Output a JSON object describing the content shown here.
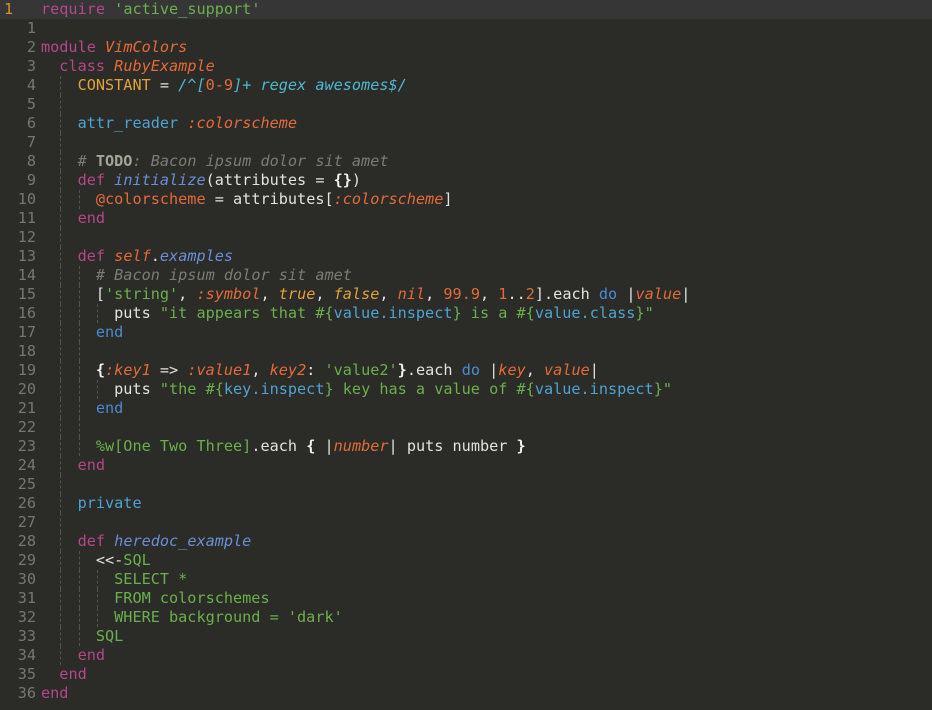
{
  "editor": {
    "language": "ruby",
    "cursor_line": 1,
    "colors": {
      "background": "#2b2b28",
      "current_line": "#363636",
      "line_number": "#777770",
      "line_number_current": "#d8922c",
      "keyword": "#b5478b",
      "method_name": "#6a8fd4",
      "class_name": "#e36b3a",
      "string": "#6ab04c",
      "comment": "#7c7c74",
      "constant": "#e0a23a"
    },
    "lines": [
      {
        "n": "1",
        "indent": [],
        "tokens": [
          [
            "t-kw",
            "require"
          ],
          [
            "t-plain",
            " "
          ],
          [
            "t-str",
            "'active_support'"
          ]
        ]
      },
      {
        "n": "1",
        "indent": [],
        "tokens": []
      },
      {
        "n": "2",
        "indent": [],
        "tokens": [
          [
            "t-kw",
            "module"
          ],
          [
            "t-plain",
            " "
          ],
          [
            "t-cls",
            "VimColors"
          ]
        ]
      },
      {
        "n": "3",
        "indent": [],
        "tokens": [
          [
            "t-plain",
            "  "
          ],
          [
            "t-kw",
            "class"
          ],
          [
            "t-plain",
            " "
          ],
          [
            "t-cls",
            "RubyExample"
          ]
        ]
      },
      {
        "n": "4",
        "indent": [
          1
        ],
        "tokens": [
          [
            "t-plain",
            "    "
          ],
          [
            "t-const",
            "CONSTANT"
          ],
          [
            "t-plain",
            " = "
          ],
          [
            "t-regex",
            "/^["
          ],
          [
            "t-num",
            "0-9"
          ],
          [
            "t-regex",
            "]+ regex awesomes$/"
          ]
        ]
      },
      {
        "n": "5",
        "indent": [
          1
        ],
        "tokens": []
      },
      {
        "n": "6",
        "indent": [
          1
        ],
        "tokens": [
          [
            "t-plain",
            "    "
          ],
          [
            "t-cyan",
            "attr_reader"
          ],
          [
            "t-plain",
            " "
          ],
          [
            "t-sym",
            ":colorscheme"
          ]
        ]
      },
      {
        "n": "7",
        "indent": [
          1
        ],
        "tokens": []
      },
      {
        "n": "8",
        "indent": [
          1
        ],
        "tokens": [
          [
            "t-plain",
            "    "
          ],
          [
            "t-cmt",
            "# "
          ],
          [
            "t-todo",
            "TODO"
          ],
          [
            "t-cmt",
            ": Bacon ipsum dolor sit amet"
          ]
        ]
      },
      {
        "n": "9",
        "indent": [
          1
        ],
        "tokens": [
          [
            "t-plain",
            "    "
          ],
          [
            "t-kw",
            "def"
          ],
          [
            "t-plain",
            " "
          ],
          [
            "t-def",
            "initialize"
          ],
          [
            "t-plain",
            "(attributes = "
          ],
          [
            "t-bold",
            "{}"
          ],
          [
            "t-plain",
            ")"
          ]
        ]
      },
      {
        "n": "10",
        "indent": [
          1,
          2
        ],
        "tokens": [
          [
            "t-plain",
            "      "
          ],
          [
            "t-ivar",
            "@colorscheme"
          ],
          [
            "t-plain",
            " = attributes["
          ],
          [
            "t-sym",
            ":colorscheme"
          ],
          [
            "t-plain",
            "]"
          ]
        ]
      },
      {
        "n": "11",
        "indent": [
          1
        ],
        "tokens": [
          [
            "t-plain",
            "    "
          ],
          [
            "t-kw",
            "end"
          ]
        ]
      },
      {
        "n": "12",
        "indent": [
          1
        ],
        "tokens": []
      },
      {
        "n": "13",
        "indent": [
          1
        ],
        "tokens": [
          [
            "t-plain",
            "    "
          ],
          [
            "t-kw",
            "def"
          ],
          [
            "t-plain",
            " "
          ],
          [
            "t-cls",
            "self"
          ],
          [
            "t-plain",
            "."
          ],
          [
            "t-def",
            "examples"
          ]
        ]
      },
      {
        "n": "14",
        "indent": [
          1,
          2
        ],
        "tokens": [
          [
            "t-plain",
            "      "
          ],
          [
            "t-cmt",
            "# Bacon ipsum dolor sit amet"
          ]
        ]
      },
      {
        "n": "15",
        "indent": [
          1,
          2
        ],
        "tokens": [
          [
            "t-plain",
            "      ["
          ],
          [
            "t-str",
            "'string'"
          ],
          [
            "t-plain",
            ", "
          ],
          [
            "t-sym",
            ":symbol"
          ],
          [
            "t-plain",
            ", "
          ],
          [
            "t-bool",
            "true"
          ],
          [
            "t-plain",
            ", "
          ],
          [
            "t-bool",
            "false"
          ],
          [
            "t-plain",
            ", "
          ],
          [
            "t-nil",
            "nil"
          ],
          [
            "t-plain",
            ", "
          ],
          [
            "t-num",
            "99.9"
          ],
          [
            "t-plain",
            ", "
          ],
          [
            "t-num",
            "1"
          ],
          [
            "t-plain",
            ".."
          ],
          [
            "t-num",
            "2"
          ],
          [
            "t-plain",
            "].each "
          ],
          [
            "t-blue",
            "do"
          ],
          [
            "t-plain",
            " |"
          ],
          [
            "t-param",
            "value"
          ],
          [
            "t-plain",
            "|"
          ]
        ]
      },
      {
        "n": "16",
        "indent": [
          1,
          2,
          3
        ],
        "tokens": [
          [
            "t-plain",
            "        puts "
          ],
          [
            "t-str",
            "\"it appears that "
          ],
          [
            "t-str",
            "#{"
          ],
          [
            "t-interp",
            "value.inspect"
          ],
          [
            "t-str",
            "}"
          ],
          [
            "t-str",
            " is a "
          ],
          [
            "t-str",
            "#{"
          ],
          [
            "t-interp",
            "value.class"
          ],
          [
            "t-str",
            "}\""
          ]
        ]
      },
      {
        "n": "17",
        "indent": [
          1,
          2
        ],
        "tokens": [
          [
            "t-plain",
            "      "
          ],
          [
            "t-blue",
            "end"
          ]
        ]
      },
      {
        "n": "18",
        "indent": [
          1,
          2
        ],
        "tokens": []
      },
      {
        "n": "19",
        "indent": [
          1,
          2
        ],
        "tokens": [
          [
            "t-plain",
            "      "
          ],
          [
            "t-bold",
            "{"
          ],
          [
            "t-sym",
            ":key1"
          ],
          [
            "t-plain",
            " => "
          ],
          [
            "t-sym",
            ":value1"
          ],
          [
            "t-plain",
            ", "
          ],
          [
            "t-sym",
            "key2"
          ],
          [
            "t-plain",
            ": "
          ],
          [
            "t-str",
            "'value2'"
          ],
          [
            "t-bold",
            "}"
          ],
          [
            "t-plain",
            ".each "
          ],
          [
            "t-blue",
            "do"
          ],
          [
            "t-plain",
            " |"
          ],
          [
            "t-param",
            "key"
          ],
          [
            "t-plain",
            ", "
          ],
          [
            "t-param",
            "value"
          ],
          [
            "t-plain",
            "|"
          ]
        ]
      },
      {
        "n": "20",
        "indent": [
          1,
          2,
          3
        ],
        "tokens": [
          [
            "t-plain",
            "        puts "
          ],
          [
            "t-str",
            "\"the "
          ],
          [
            "t-str",
            "#{"
          ],
          [
            "t-interp",
            "key.inspect"
          ],
          [
            "t-str",
            "}"
          ],
          [
            "t-str",
            " key has a value of "
          ],
          [
            "t-str",
            "#{"
          ],
          [
            "t-interp",
            "value.inspect"
          ],
          [
            "t-str",
            "}\""
          ]
        ]
      },
      {
        "n": "21",
        "indent": [
          1,
          2
        ],
        "tokens": [
          [
            "t-plain",
            "      "
          ],
          [
            "t-blue",
            "end"
          ]
        ]
      },
      {
        "n": "22",
        "indent": [
          1,
          2
        ],
        "tokens": []
      },
      {
        "n": "23",
        "indent": [
          1,
          2
        ],
        "tokens": [
          [
            "t-plain",
            "      "
          ],
          [
            "t-str",
            "%w[One Two Three]"
          ],
          [
            "t-plain",
            ".each "
          ],
          [
            "t-bold",
            "{"
          ],
          [
            "t-plain",
            " |"
          ],
          [
            "t-param",
            "number"
          ],
          [
            "t-plain",
            "| puts number "
          ],
          [
            "t-bold",
            "}"
          ]
        ]
      },
      {
        "n": "24",
        "indent": [
          1
        ],
        "tokens": [
          [
            "t-plain",
            "    "
          ],
          [
            "t-kw",
            "end"
          ]
        ]
      },
      {
        "n": "25",
        "indent": [
          1
        ],
        "tokens": []
      },
      {
        "n": "26",
        "indent": [
          1
        ],
        "tokens": [
          [
            "t-plain",
            "    "
          ],
          [
            "t-cyan",
            "private"
          ]
        ]
      },
      {
        "n": "27",
        "indent": [
          1
        ],
        "tokens": []
      },
      {
        "n": "28",
        "indent": [
          1
        ],
        "tokens": [
          [
            "t-plain",
            "    "
          ],
          [
            "t-kw",
            "def"
          ],
          [
            "t-plain",
            " "
          ],
          [
            "t-def",
            "heredoc_example"
          ]
        ]
      },
      {
        "n": "29",
        "indent": [
          1,
          2
        ],
        "tokens": [
          [
            "t-plain",
            "      <<-"
          ],
          [
            "t-str",
            "SQL"
          ]
        ]
      },
      {
        "n": "30",
        "indent": [
          1,
          2,
          3
        ],
        "tokens": [
          [
            "t-plain",
            "        "
          ],
          [
            "t-str",
            "SELECT *"
          ]
        ]
      },
      {
        "n": "31",
        "indent": [
          1,
          2,
          3
        ],
        "tokens": [
          [
            "t-plain",
            "        "
          ],
          [
            "t-str",
            "FROM colorschemes"
          ]
        ]
      },
      {
        "n": "32",
        "indent": [
          1,
          2,
          3
        ],
        "tokens": [
          [
            "t-plain",
            "        "
          ],
          [
            "t-str",
            "WHERE background = 'dark'"
          ]
        ]
      },
      {
        "n": "33",
        "indent": [
          1,
          2
        ],
        "tokens": [
          [
            "t-plain",
            "      "
          ],
          [
            "t-str",
            "SQL"
          ]
        ]
      },
      {
        "n": "34",
        "indent": [
          1
        ],
        "tokens": [
          [
            "t-plain",
            "    "
          ],
          [
            "t-kw",
            "end"
          ]
        ]
      },
      {
        "n": "35",
        "indent": [],
        "tokens": [
          [
            "t-plain",
            "  "
          ],
          [
            "t-kw",
            "end"
          ]
        ]
      },
      {
        "n": "36",
        "indent": [],
        "tokens": [
          [
            "t-kw",
            "end"
          ]
        ]
      }
    ]
  }
}
